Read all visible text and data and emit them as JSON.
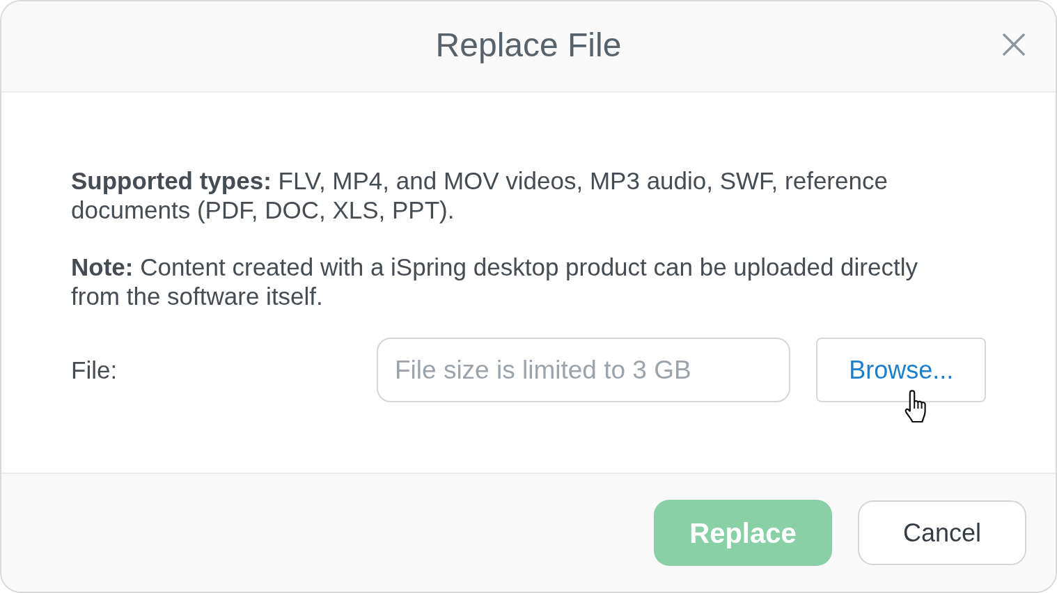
{
  "dialog": {
    "title": "Replace File"
  },
  "notes": [
    "**Supported types:** FLV, MP4, and MOV videos, MP3 audio, SWF, reference documents (PDF, DOC, XLS, PPT).",
    "**Note:** Content created with a iSpring desktop product can be uploaded directly from the software itself."
  ],
  "file_field": {
    "label": "File:",
    "placeholder": "File size is limited to 3 GB",
    "browse_button": "Browse..."
  },
  "buttons": [
    {
      "label": "Replace",
      "kind": "primary",
      "disabled": true
    },
    {
      "label": "Cancel",
      "kind": "secondary",
      "disabled": false
    }
  ]
}
